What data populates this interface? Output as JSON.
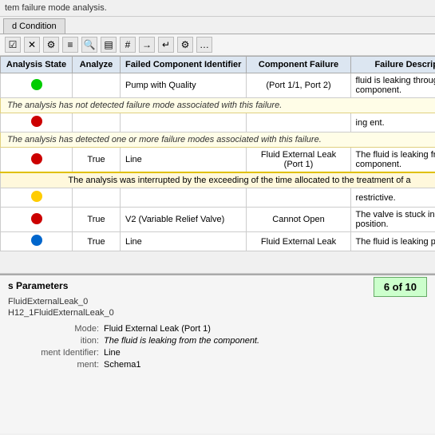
{
  "topbar": {
    "text": "tem failure mode analysis."
  },
  "tabs": [
    {
      "label": "d Condition"
    }
  ],
  "toolbar": {
    "buttons": [
      "checkbox",
      "x",
      "filter1",
      "filter2",
      "view1",
      "view2",
      "hash",
      "arrow-right",
      "arrow-in",
      "gear",
      "ellipsis"
    ]
  },
  "table": {
    "headers": [
      {
        "id": "analysis-state",
        "label": "Analysis State"
      },
      {
        "id": "analyze",
        "label": "Analyze"
      },
      {
        "id": "failed-component",
        "label": "Failed Component Identifier"
      },
      {
        "id": "component-failure",
        "label": "Component Failure"
      },
      {
        "id": "failure-description",
        "label": "Failure Description"
      }
    ],
    "rows": [
      {
        "type": "data",
        "dot": "green",
        "analyze": "",
        "failed_component": "Pump with Quality",
        "component_failure": "(Port 1/1, Port 2)",
        "failure_description": "fluid is leaking through the component."
      },
      {
        "type": "notification",
        "message": "The analysis has not detected failure mode associated with this failure."
      },
      {
        "type": "data",
        "dot": "red",
        "analyze": "",
        "failed_component": "",
        "component_failure": "",
        "failure_description": "ing ent."
      },
      {
        "type": "notification",
        "message": "The analysis has detected one or more failure modes associated with this failure."
      },
      {
        "type": "data",
        "dot": "red",
        "analyze": "True",
        "failed_component": "Line",
        "component_failure": "Fluid External Leak (Port 1)",
        "failure_description": "The fluid is leaking from the component."
      },
      {
        "type": "notification-warn",
        "message": "The analysis was interrupted by the exceeding of the time allocated to the treatment of a"
      },
      {
        "type": "data",
        "dot": "yellow",
        "analyze": "",
        "failed_component": "",
        "component_failure": "",
        "failure_description": "restrictive."
      },
      {
        "type": "data2",
        "dot": "red",
        "analyze": "True",
        "failed_component": "V2 (Variable Relief Valve)",
        "component_failure": "Cannot Open",
        "failure_description": "The valve is stuck in closed position."
      },
      {
        "type": "data",
        "dot": "blue",
        "analyze": "True",
        "failed_component": "Line",
        "component_failure": "Fluid External Leak",
        "failure_description": "The fluid is leaking ponent."
      }
    ]
  },
  "bottom_panel": {
    "title": "s Parameters",
    "counter": "6 of 10",
    "ids": [
      "FluidExternalLeak_0",
      "H12_1FluidExternalLeak_0"
    ],
    "params": [
      {
        "label": "Mode:",
        "value": "Fluid External Leak (Port 1)"
      },
      {
        "label": "ition:",
        "value": "The fluid is leaking from the component."
      },
      {
        "label": "ment Identifier:",
        "value": "Line"
      },
      {
        "label": "ment:",
        "value": "Schema1"
      }
    ]
  }
}
